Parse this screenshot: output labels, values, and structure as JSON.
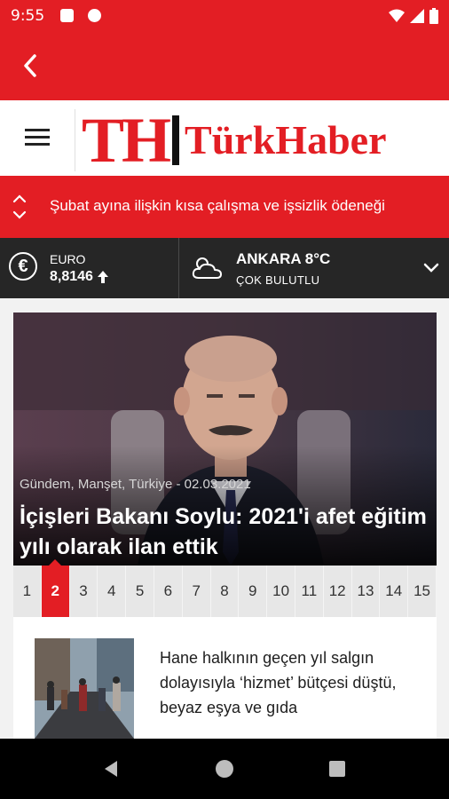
{
  "status_bar": {
    "time": "9:55"
  },
  "logo": {
    "mark": "TH",
    "name": "TürkHaber"
  },
  "ticker": {
    "text": "Şubat ayına ilişkin kısa çalışma ve işsizlik ödeneği"
  },
  "currency": {
    "label": "EURO",
    "value": "8,8146",
    "trend_icon": "arrow-up-icon"
  },
  "weather": {
    "city": "ANKARA 8°C",
    "description": "ÇOK BULUTLU",
    "icon": "cloud-sun-icon"
  },
  "hero": {
    "meta": "Gündem, Manşet, Türkiye  -  02.03.2021",
    "title": "İçişleri Bakanı Soylu: 2021'i afet eğitim yılı olarak ilan ettik"
  },
  "pagination": {
    "active": "2",
    "pages": [
      "1",
      "2",
      "3",
      "4",
      "5",
      "6",
      "7",
      "8",
      "9",
      "10",
      "11",
      "12",
      "13",
      "14",
      "15"
    ]
  },
  "news": [
    {
      "title": "Hane halkının geçen yıl salgın dolayısıyla ‘hizmet’ bütçesi düştü, beyaz eşya ve gıda"
    }
  ],
  "colors": {
    "brand": "#e31e24",
    "dark_bar": "#262626",
    "background": "#f2f2f2"
  }
}
